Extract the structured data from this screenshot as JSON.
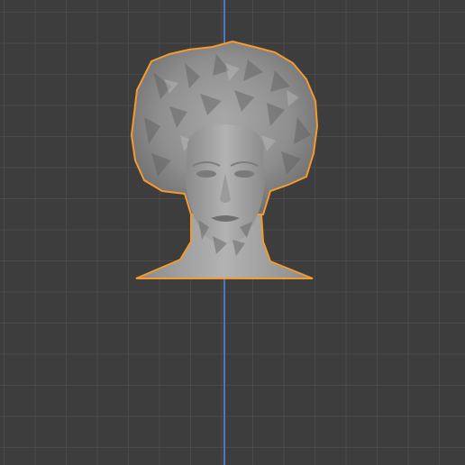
{
  "viewport": {
    "background_color": "#3d3d3d",
    "grid_color": "#555555",
    "z_axis_color": "#4a78c4",
    "selection_outline_color": "#f29b2f"
  },
  "object": {
    "name": "head-bust",
    "selected": true,
    "shading": "solid-gray"
  }
}
